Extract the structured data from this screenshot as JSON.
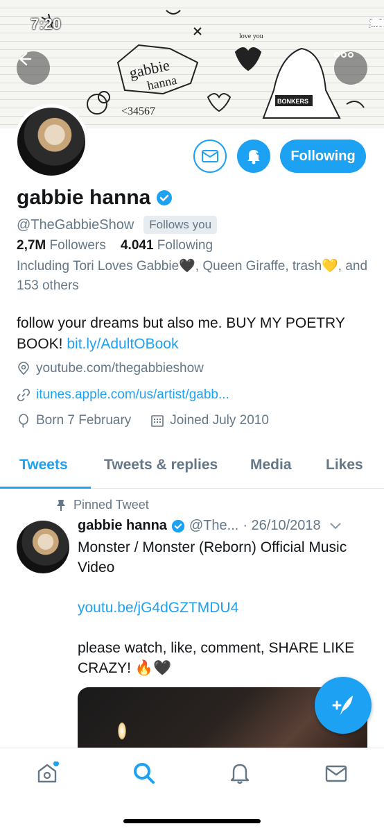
{
  "status_bar": {
    "time": "7:20"
  },
  "banner": {
    "doodle_texts": [
      "gabbie",
      "hanna",
      "<34567",
      "BONKERS",
      "love you"
    ]
  },
  "profile": {
    "name": "gabbie hanna",
    "handle": "@TheGabbieShow",
    "follows_you": "Follows you",
    "followers_count": "2,7M",
    "followers_label": "Followers",
    "following_count": "4.041",
    "following_label": "Following",
    "known_followers": "Including Tori Loves Gabbie🖤, Queen Giraffe, trash💛, and 153 others",
    "bio_text": "follow your dreams but also me. BUY MY POETRY BOOK! ",
    "bio_link": "bit.ly/AdultOBook",
    "location": "youtube.com/thegabbieshow",
    "website": "itunes.apple.com/us/artist/gabb...",
    "birthday": "Born 7 February",
    "joined": "Joined July 2010"
  },
  "actions": {
    "following_label": "Following"
  },
  "tabs": [
    {
      "label": "Tweets",
      "active": true
    },
    {
      "label": "Tweets & replies"
    },
    {
      "label": "Media"
    },
    {
      "label": "Likes"
    }
  ],
  "tweet": {
    "pinned_label": "Pinned Tweet",
    "author": "gabbie hanna",
    "handle": "@The...",
    "date": "· 26/10/2018",
    "text_line1": "Monster / Monster (Reborn) Official Music Video",
    "link": "youtu.be/jG4dGZTMDU4",
    "text_line2": "please watch, like, comment, SHARE LIKE CRAZY! 🔥🖤"
  },
  "colors": {
    "accent": "#1da1f2",
    "secondary_text": "#657786",
    "border": "#e1e8ed"
  },
  "icons": {
    "back": "back-arrow-icon",
    "more": "more-icon",
    "mail": "mail-icon",
    "bell": "bell-icon",
    "verified": "verified-badge-icon",
    "location": "location-icon",
    "link": "link-icon",
    "birthday": "balloon-icon",
    "calendar": "calendar-icon",
    "pin": "pin-icon",
    "compose": "compose-icon",
    "home": "home-icon",
    "search": "search-icon",
    "notifications": "bell-icon",
    "messages": "mail-icon"
  }
}
